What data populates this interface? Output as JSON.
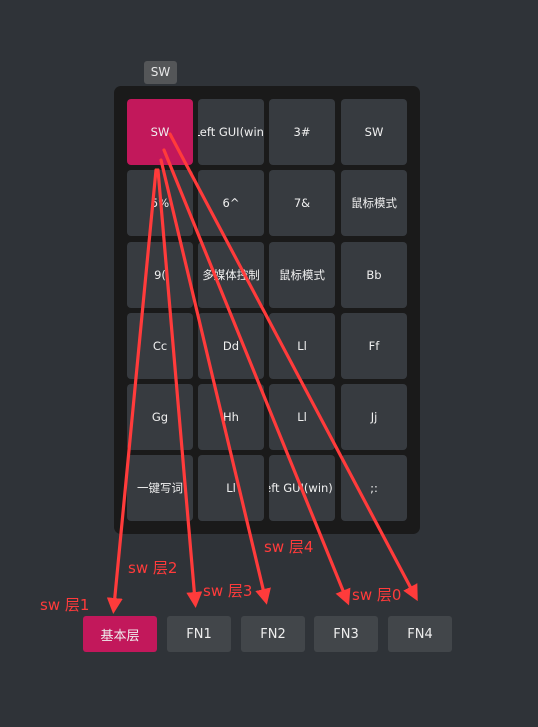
{
  "tag_label": "SW",
  "keys": [
    [
      "SW",
      "Left GUI(win)",
      "3#",
      "SW"
    ],
    [
      "5%",
      "6^",
      "7&",
      "鼠标模式"
    ],
    [
      "9(",
      "多媒体控制",
      "鼠标模式",
      "Bb"
    ],
    [
      "Cc",
      "Dd",
      "Ll",
      "Ff"
    ],
    [
      "Gg",
      "Hh",
      "Ll",
      "Jj"
    ],
    [
      "一键写词",
      "Ll",
      "Left GUI(win) + ",
      ";:"
    ]
  ],
  "layers": [
    "基本层",
    "FN1",
    "FN2",
    "FN3",
    "FN4"
  ],
  "annotations": {
    "sw1": "sw 层1",
    "sw2": "sw 层2",
    "sw3": "sw 层3",
    "sw4": "sw 层4",
    "sw0": "sw 层0"
  },
  "colors": {
    "accent": "#c2185b",
    "arrow": "#ff3b3b"
  }
}
